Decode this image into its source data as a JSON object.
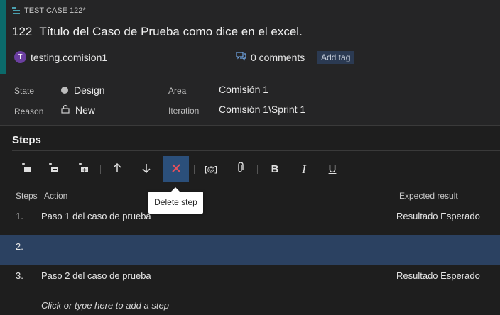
{
  "header": {
    "type_label": "TEST CASE 122*",
    "id": "122",
    "title": "Título del Caso de Prueba como dice en el excel.",
    "owner_initial": "T",
    "owner": "testing.comision1",
    "comments": "0 comments",
    "add_tag": "Add tag"
  },
  "fields": {
    "state_label": "State",
    "state_value": "Design",
    "reason_label": "Reason",
    "reason_value": "New",
    "area_label": "Area",
    "area_value": "Comisión 1",
    "iteration_label": "Iteration",
    "iteration_value": "Comisión 1\\Sprint 1"
  },
  "steps": {
    "title": "Steps",
    "tooltip": "Delete step",
    "columns": {
      "steps": "Steps",
      "action": "Action",
      "expected": "Expected result"
    },
    "rows": [
      {
        "num": "1.",
        "action": "Paso 1 del caso de prueba",
        "expected": "Resultado Esperado"
      },
      {
        "num": "2.",
        "action": "",
        "expected": ""
      },
      {
        "num": "3.",
        "action": "Paso 2 del caso de prueba",
        "expected": "Resultado Esperado"
      }
    ],
    "add_placeholder": "Click or type here to add a step"
  },
  "toolbar": {
    "bold": "B",
    "italic": "I",
    "underline": "U",
    "param": "[@]"
  },
  "colors": {
    "accent": "#0b6a6a",
    "selected_row": "#2b4161",
    "active_button": "#2b4f7a"
  }
}
